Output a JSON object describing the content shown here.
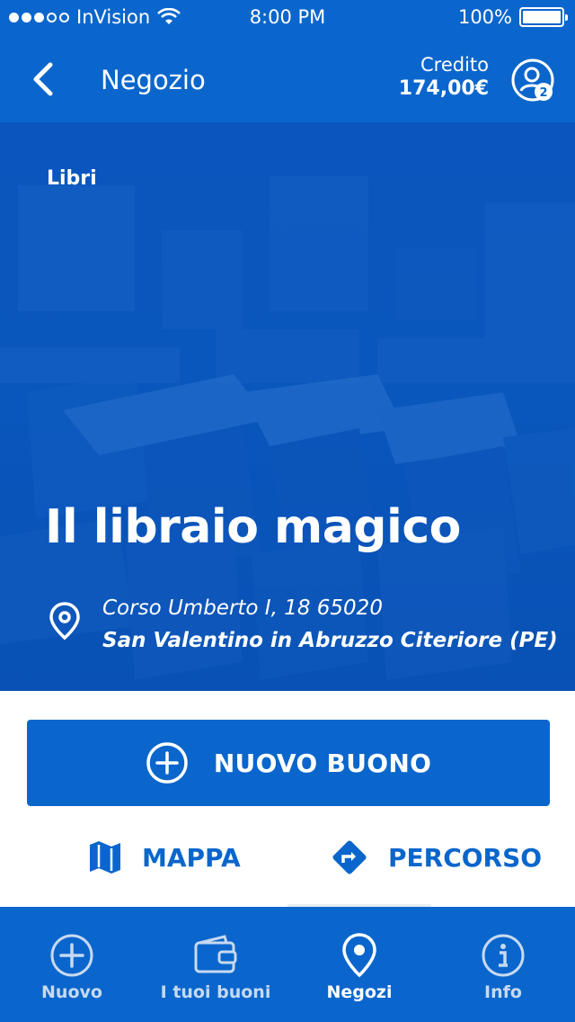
{
  "status_bar": {
    "carrier": "InVision",
    "time": "8:00 PM",
    "battery": "100%"
  },
  "nav": {
    "title": "Negozio",
    "credit_label": "Credito",
    "credit_value": "174,00€",
    "profile_badge": "2"
  },
  "shop": {
    "category": "Libri",
    "name": "Il libraio magico",
    "address_line1": "Corso Umberto I, 18 65020",
    "address_line2": "San Valentino in Abruzzo Citeriore (PE)"
  },
  "actions": {
    "new_voucher": "NUOVO BUONO",
    "map": "MAPPA",
    "route": "PERCORSO"
  },
  "tabs": [
    {
      "label": "Nuovo",
      "icon": "plus-circle-icon"
    },
    {
      "label": "I tuoi buoni",
      "icon": "wallet-icon"
    },
    {
      "label": "Negozi",
      "icon": "location-pin-icon",
      "active": true
    },
    {
      "label": "Info",
      "icon": "info-icon"
    }
  ],
  "colors": {
    "brand_blue": "#0a66cc",
    "tab_inactive": "#c7d9f1",
    "white": "#ffffff"
  }
}
